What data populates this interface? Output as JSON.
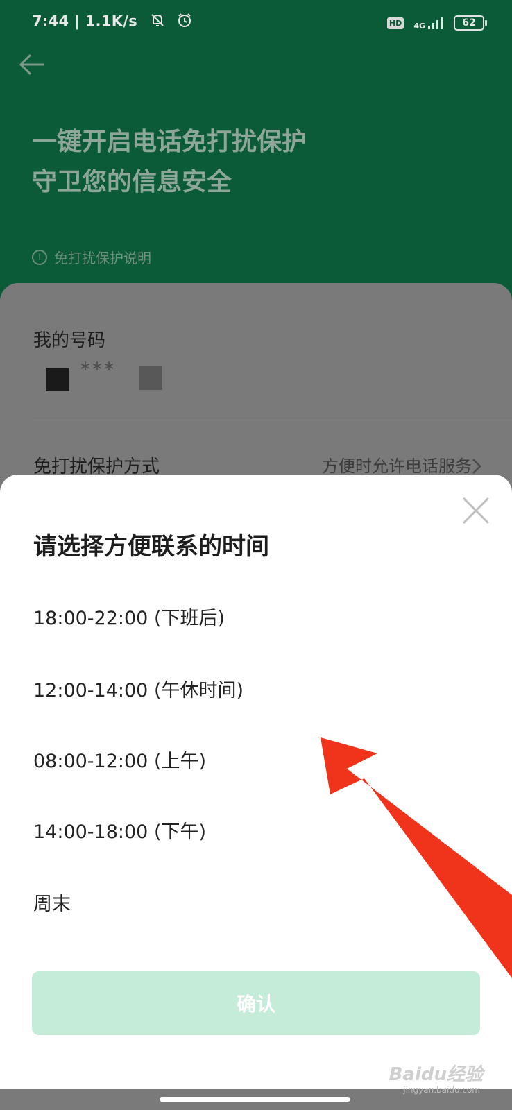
{
  "status_bar": {
    "time_speed": "7:44 | 1.1K/s",
    "hd": "HD",
    "network": "4G",
    "battery": "62"
  },
  "header": {
    "headline_line1": "一键开启电话免打扰保护",
    "headline_line2": "守卫您的信息安全",
    "info_link": "免打扰保护说明"
  },
  "card": {
    "my_number_label": "我的号码",
    "masked_number": "***",
    "mode_label": "免打扰保护方式",
    "mode_value": "方便时允许电话服务"
  },
  "sheet": {
    "title": "请选择方便联系的时间",
    "options": [
      "18:00-22:00 (下班后)",
      "12:00-14:00 (午休时间)",
      "08:00-12:00 (上午)",
      "14:00-18:00 (下午)",
      "周末"
    ],
    "confirm_label": "确认"
  },
  "watermark": {
    "brand": "Baidu经验",
    "site": "jingyan.baidu.com"
  },
  "colors": {
    "header_green": "#0b5a38",
    "confirm_disabled": "#c5ecd8",
    "annotation_arrow": "#f0341c"
  }
}
